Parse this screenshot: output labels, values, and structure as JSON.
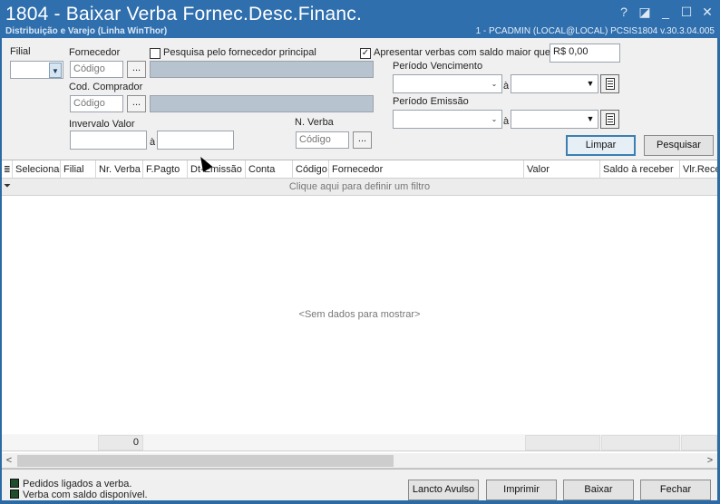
{
  "window": {
    "title": "1804 - Baixar Verba Fornec.Desc.Financ.",
    "subtitle": "Distribuição e Varejo (Linha WinThor)",
    "session": "1 - PCADMIN (LOCAL@LOCAL)   PCSIS1804   v.30.3.04.005",
    "controls": {
      "help": "?",
      "restore": "◪",
      "minimize": "_",
      "maximize": "☐",
      "close": "✕"
    }
  },
  "filters": {
    "filial_label": "Filial",
    "fornecedor_label": "Fornecedor",
    "codigo_placeholder": "Código",
    "dots": "...",
    "pesquisa_principal_label": "Pesquisa pelo fornecedor principal",
    "pesquisa_principal_checked": false,
    "saldo_maior_label": "Apresentar verbas com saldo maior que",
    "saldo_maior_checked": true,
    "saldo_value": "R$ 0,00",
    "cod_comprador_label": "Cod. Comprador",
    "intervalo_valor_label": "Invervalo Valor",
    "a_label": "à",
    "n_verba_label": "N. Verba",
    "periodo_vencimento_label": "Período Vencimento",
    "periodo_emissao_label": "Período Emissão",
    "limpar_label": "Limpar",
    "pesquisar_label": "Pesquisar"
  },
  "grid": {
    "columns": [
      "Selecionad",
      "Filial",
      "Nr. Verba",
      "F.Pagto",
      "Dt-Emissão",
      "Conta",
      "Código",
      "Fornecedor",
      "Valor",
      "Saldo à receber",
      "Vlr.Rece"
    ],
    "filter_prompt": "Clique aqui para definir um filtro",
    "empty_message": "<Sem dados para mostrar>",
    "footer_count": "0"
  },
  "legend": [
    {
      "label": "Pedidos ligados a verba.",
      "color": "#1f4e2a"
    },
    {
      "label": "Verba com saldo disponível.",
      "color": "#1f4e2a"
    }
  ],
  "actions": {
    "lancto_avulso": "Lancto Avulso",
    "imprimir": "Imprimir",
    "baixar": "Baixar",
    "fechar": "Fechar"
  }
}
